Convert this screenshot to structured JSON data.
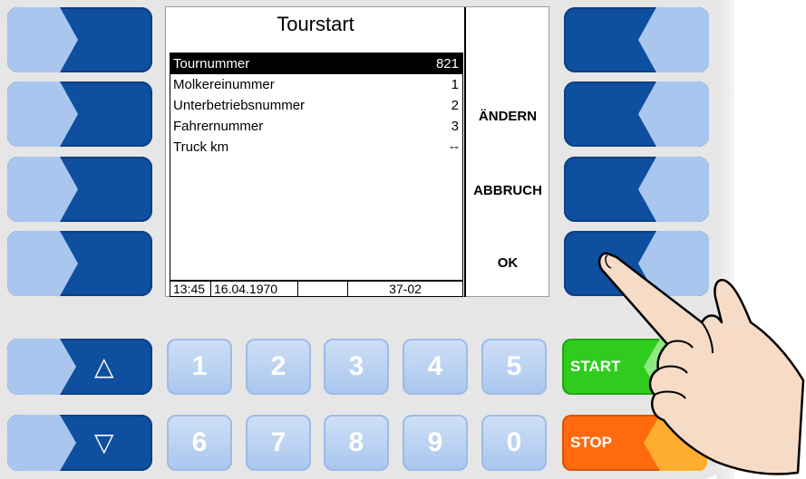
{
  "screen": {
    "title": "Tourstart",
    "rows": [
      {
        "label": "Tournummer",
        "value": "821"
      },
      {
        "label": "Molkereinummer",
        "value": "1"
      },
      {
        "label": "Unterbetriebsnummer",
        "value": "2"
      },
      {
        "label": "Fahrernummer",
        "value": "3"
      },
      {
        "label": "Truck km",
        "value": "--"
      }
    ],
    "status": {
      "time": "13:45",
      "date": "16.04.1970",
      "empty": "",
      "code": "37-02"
    },
    "softkeys": {
      "change": "ÄNDERN",
      "cancel": "ABBRUCH",
      "ok": "OK"
    }
  },
  "keys": {
    "digits_top": [
      "1",
      "2",
      "3",
      "4",
      "5"
    ],
    "digits_bottom": [
      "6",
      "7",
      "8",
      "9",
      "0"
    ],
    "start": "START",
    "stop": "STOP",
    "up": "△",
    "down": "▽"
  },
  "colors": {
    "key_dark": "#0f4fa0",
    "key_light": "#a9c6ee",
    "start_green": "#2fcc1e",
    "stop_orange": "#ff6a0e"
  }
}
